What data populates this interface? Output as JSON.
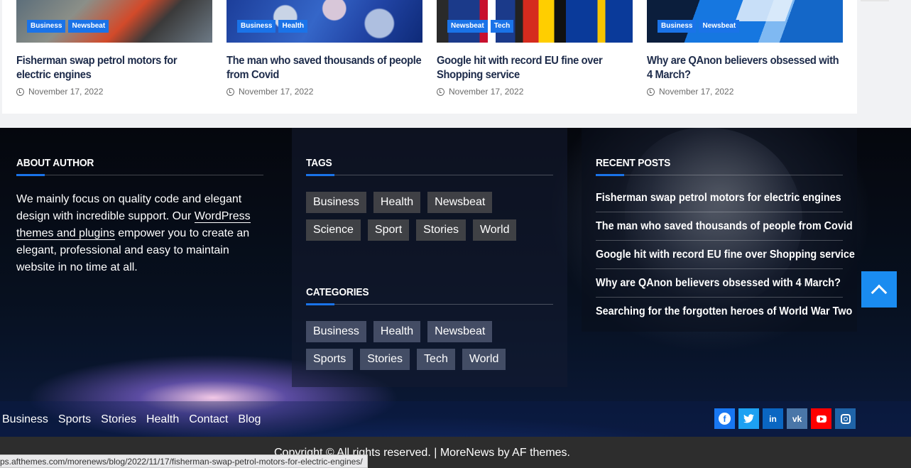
{
  "related_posts": [
    {
      "categories": [
        "Business",
        "Newsbeat"
      ],
      "title": "Fisherman swap petrol motors for electric engines",
      "date": "November 17, 2022"
    },
    {
      "categories": [
        "Business",
        "Health"
      ],
      "title": "The man who saved thousands of people from Covid",
      "date": "November 17, 2022"
    },
    {
      "categories": [
        "Newsbeat",
        "Tech"
      ],
      "title": "Google hit with record EU fine over Shopping service",
      "date": "November 17, 2022"
    },
    {
      "categories": [
        "Business",
        "Newsbeat"
      ],
      "title": "Why are QAnon believers obsessed with 4 March?",
      "date": "November 17, 2022"
    }
  ],
  "about": {
    "title": "ABOUT AUTHOR",
    "text_before": "We mainly focus on quality code and elegant design with incredible support. Our ",
    "link_text": "WordPress themes and plugins",
    "text_after": " empower you to create an elegant, professional and easy to maintain website in no time at all."
  },
  "tags": {
    "title": "TAGS",
    "items": [
      "Business",
      "Health",
      "Newsbeat",
      "Science",
      "Sport",
      "Stories",
      "World"
    ]
  },
  "categories": {
    "title": "CATEGORIES",
    "items": [
      "Business",
      "Health",
      "Newsbeat",
      "Sports",
      "Stories",
      "Tech",
      "World"
    ]
  },
  "recent_posts": {
    "title": "RECENT POSTS",
    "items": [
      "Fisherman swap petrol motors for electric engines",
      "The man who saved thousands of people from Covid",
      "Google hit with record EU fine over Shopping service",
      "Why are QAnon believers obsessed with 4 March?",
      "Searching for the forgotten heroes of World War Two"
    ]
  },
  "footer_menu": [
    "Business",
    "Sports",
    "Stories",
    "Health",
    "Contact",
    "Blog"
  ],
  "social": [
    {
      "name": "facebook-icon",
      "glyph": "f",
      "color": "#1877f2"
    },
    {
      "name": "twitter-icon",
      "glyph": "🐦",
      "color": "#1da1f2"
    },
    {
      "name": "linkedin-icon",
      "glyph": "in",
      "color": "#0a66c2"
    },
    {
      "name": "vk-icon",
      "glyph": "vk",
      "color": "#4a76a8"
    },
    {
      "name": "youtube-icon",
      "glyph": "",
      "color": "#ff0000"
    },
    {
      "name": "instagram-icon",
      "glyph": "",
      "color": "#1f64a8"
    }
  ],
  "copyright": "Copyright © All rights reserved. | MoreNews by AF themes.",
  "status_url": "ps.afthemes.com/morenews/blog/2022/11/17/fisherman-swap-petrol-motors-for-electric-engines/",
  "accent_color": "#1a73e8"
}
